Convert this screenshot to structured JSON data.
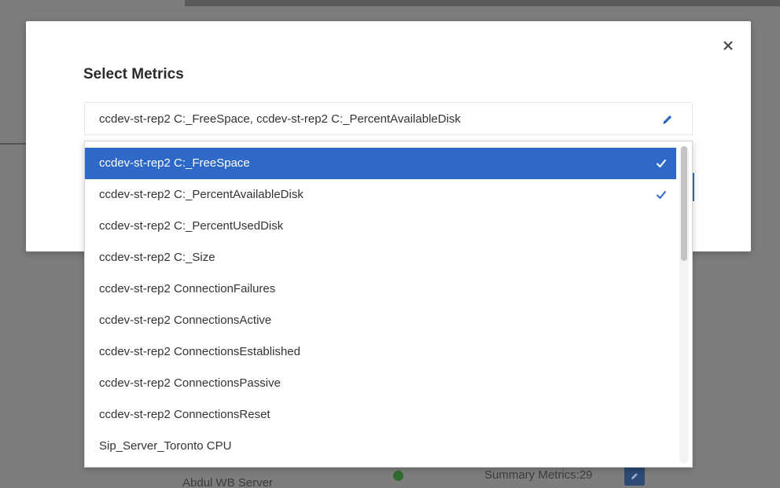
{
  "modal": {
    "title": "Select Metrics",
    "close_icon": "close-icon",
    "field_value": "ccdev-st-rep2 C:_FreeSpace, ccdev-st-rep2 C:_PercentAvailableDisk",
    "field_icon": "pencil-icon"
  },
  "dropdown": {
    "items": [
      {
        "label": "ccdev-st-rep2 C:_FreeSpace",
        "selected": true,
        "checked": true
      },
      {
        "label": "ccdev-st-rep2 C:_PercentAvailableDisk",
        "selected": false,
        "checked": true
      },
      {
        "label": "ccdev-st-rep2 C:_PercentUsedDisk",
        "selected": false,
        "checked": false
      },
      {
        "label": "ccdev-st-rep2 C:_Size",
        "selected": false,
        "checked": false
      },
      {
        "label": "ccdev-st-rep2 ConnectionFailures",
        "selected": false,
        "checked": false
      },
      {
        "label": "ccdev-st-rep2 ConnectionsActive",
        "selected": false,
        "checked": false
      },
      {
        "label": "ccdev-st-rep2 ConnectionsEstablished",
        "selected": false,
        "checked": false
      },
      {
        "label": "ccdev-st-rep2 ConnectionsPassive",
        "selected": false,
        "checked": false
      },
      {
        "label": "ccdev-st-rep2 ConnectionsReset",
        "selected": false,
        "checked": false
      },
      {
        "label": "Sip_Server_Toronto CPU",
        "selected": false,
        "checked": false
      }
    ],
    "scroll_fraction": 0.0
  },
  "background": {
    "server_name": "Abdul WB Server",
    "summary_label": "Summary Metrics:29",
    "status_icon": "status-ok-icon",
    "edit_icon": "pencil-icon"
  },
  "colors": {
    "accent": "#2f69c8",
    "selected_text": "#ffffff",
    "check": "#2f69c8"
  }
}
